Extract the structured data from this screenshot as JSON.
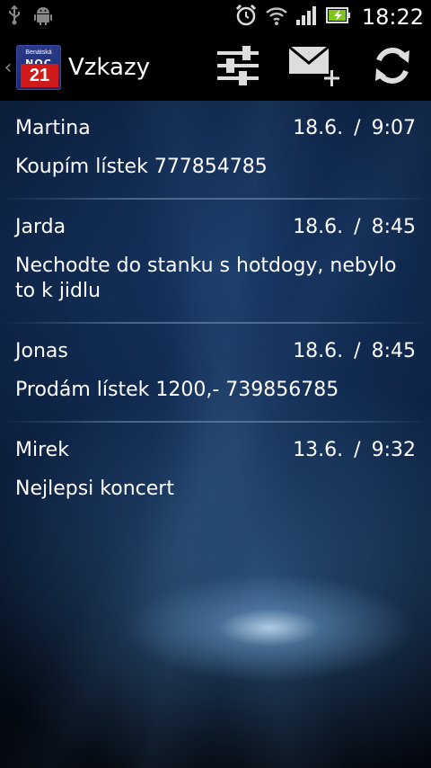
{
  "status_bar": {
    "time": "18:22",
    "icons": [
      "usb-icon",
      "android-debug-icon",
      "alarm-icon",
      "wifi-icon",
      "signal-icon",
      "battery-charging-icon"
    ]
  },
  "action_bar": {
    "title": "Vzkazy",
    "app_icon": {
      "brand": "Benátská",
      "line1": "NOC",
      "line2": "21"
    },
    "actions": [
      "settings-sliders-icon",
      "new-message-icon",
      "refresh-icon"
    ]
  },
  "messages": [
    {
      "sender": "Martina",
      "date": "18.6.",
      "separator": "/",
      "time": "9:07",
      "text": "Koupím lístek 777854785"
    },
    {
      "sender": "Jarda",
      "date": "18.6.",
      "separator": "/",
      "time": "8:45",
      "text": "Nechodte do stanku s hotdogy, nebylo to k jidlu"
    },
    {
      "sender": "Jonas",
      "date": "18.6.",
      "separator": "/",
      "time": "8:45",
      "text": "Prodám lístek 1200,- 739856785"
    },
    {
      "sender": "Mirek",
      "date": "13.6.",
      "separator": "/",
      "time": "9:32",
      "text": "Nejlepsi koncert"
    }
  ],
  "colors": {
    "status_bar_bg": "#000000",
    "action_bar_bg": "#000000",
    "text": "#ffffff",
    "app_icon_red": "#d11a1a",
    "app_icon_blue": "#2a3a8a"
  }
}
